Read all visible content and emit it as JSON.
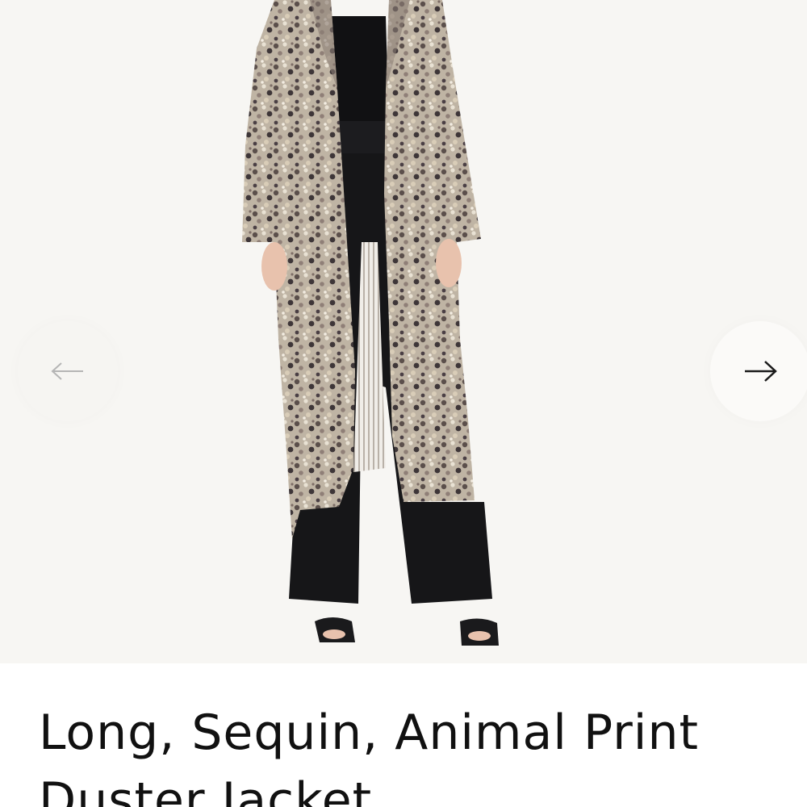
{
  "gallery": {
    "image_alt": "Model wearing a long sequin animal print duster jacket over a black top and wide-leg black trousers",
    "prev_icon": "arrow-left-icon",
    "next_icon": "arrow-right-icon",
    "colors": {
      "background": "#f7f6f3",
      "arrow_prev": "#b5b5b5",
      "arrow_next": "#1a1a1a"
    }
  },
  "product": {
    "title": "Long, Sequin, Animal Print Duster Jacket"
  }
}
